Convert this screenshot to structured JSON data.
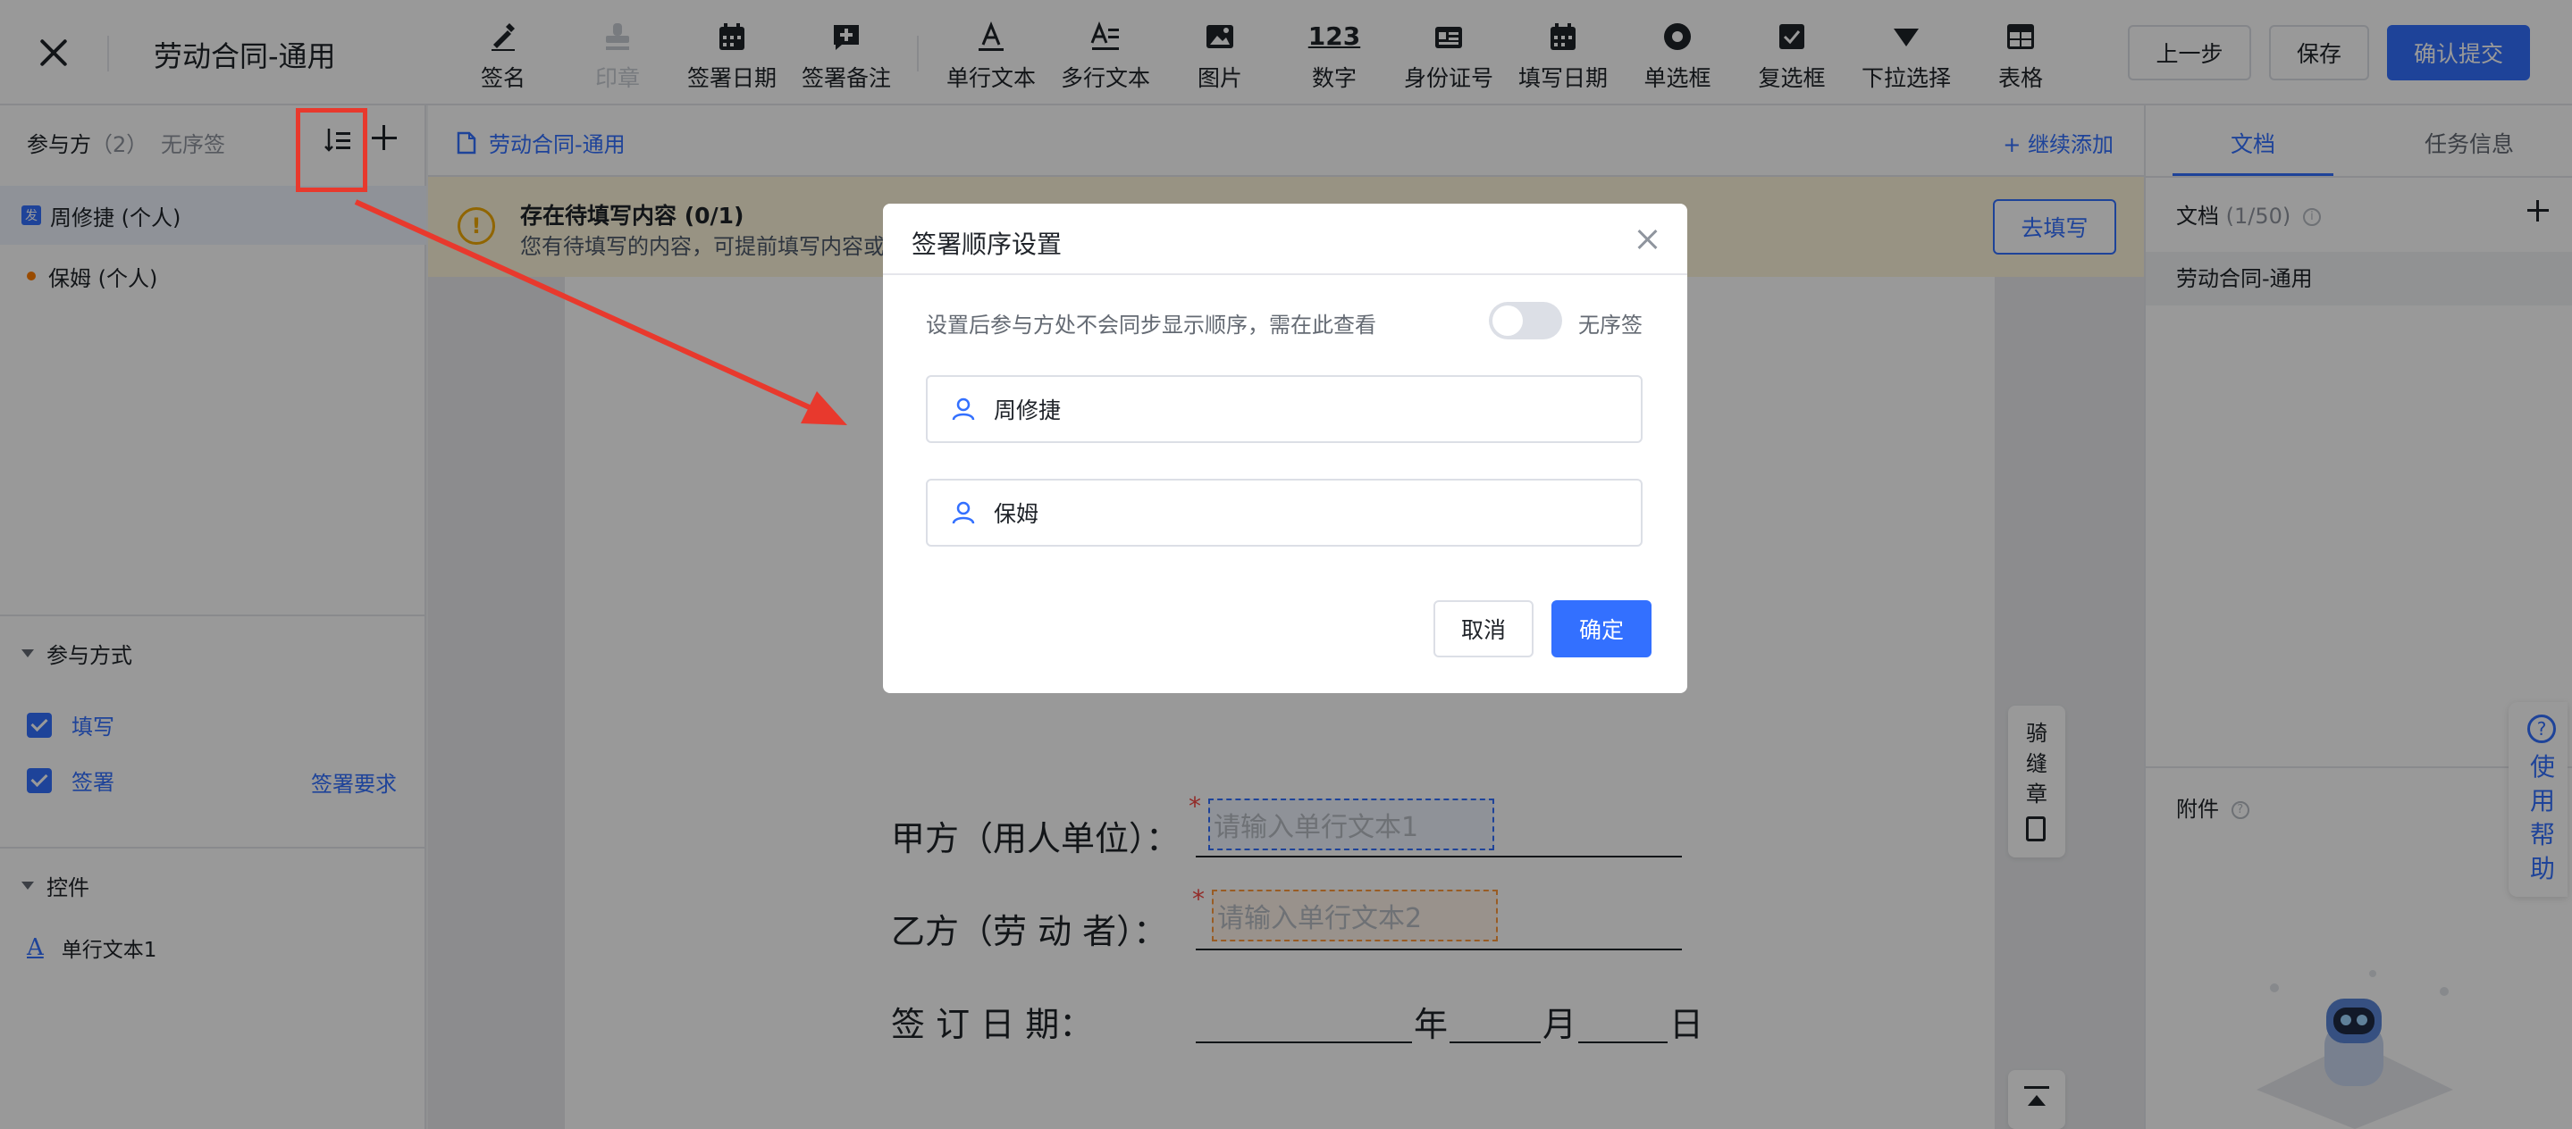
{
  "topbar": {
    "title": "劳动合同-通用",
    "tools": [
      {
        "label": "签名",
        "icon": "signature-icon"
      },
      {
        "label": "印章",
        "icon": "stamp-icon",
        "disabled": true
      },
      {
        "label": "签署日期",
        "icon": "calendar-icon"
      },
      {
        "label": "签署备注",
        "icon": "note-plus-icon"
      },
      {
        "label": "单行文本",
        "icon": "text-icon"
      },
      {
        "label": "多行文本",
        "icon": "multiline-text-icon"
      },
      {
        "label": "图片",
        "icon": "image-icon"
      },
      {
        "label": "数字",
        "icon": "number-icon"
      },
      {
        "label": "身份证号",
        "icon": "id-card-icon"
      },
      {
        "label": "填写日期",
        "icon": "calendar-icon"
      },
      {
        "label": "单选框",
        "icon": "radio-icon"
      },
      {
        "label": "复选框",
        "icon": "checkbox-icon"
      },
      {
        "label": "下拉选择",
        "icon": "dropdown-icon"
      },
      {
        "label": "表格",
        "icon": "table-icon"
      }
    ],
    "number_glyph": "123",
    "prev_label": "上一步",
    "save_label": "保存",
    "submit_label": "确认提交"
  },
  "left": {
    "parties_label": "参与方",
    "parties_count": "（2）",
    "unordered_label": "无序签",
    "parties": [
      {
        "badge": "发",
        "name": "周修捷 (个人)"
      },
      {
        "name": "保姆 (个人)"
      }
    ],
    "mode_title": "参与方式",
    "mode_fill": "填写",
    "mode_sign": "签署",
    "sign_requirements": "签署要求",
    "controls_title": "控件",
    "control_item": "单行文本1",
    "control_icon_glyph": "A"
  },
  "center": {
    "doc_name": "劳动合同-通用",
    "continue_add": "+ 继续添加",
    "banner_title": "存在待填写内容 (0/1)",
    "banner_desc": "您有待填写的内容，可提前填写内容或",
    "banner_button": "去填写",
    "party_a_label": "甲方（用人单位）：",
    "party_b_label": "乙方（劳  动  者）：",
    "date_label": "签    订    日    期：",
    "field1_placeholder": "请输入单行文本1",
    "field2_placeholder": "请输入单行文本2",
    "year": "年",
    "month": "月",
    "day": "日",
    "side_label": "骑缝章",
    "required_mark": "*"
  },
  "right": {
    "tab_doc": "文档",
    "tab_task": "任务信息",
    "doc_label": "文档",
    "doc_count": "(1/50)",
    "file_name": "劳动合同-通用",
    "attach_label": "附件",
    "help_label": "使用帮助",
    "info_glyph": "i",
    "help_glyph": "?"
  },
  "modal": {
    "title": "签署顺序设置",
    "desc": "设置后参与方处不会同步显示顺序，需在此查看",
    "toggle_label": "无序签",
    "toggle_on": false,
    "signers": [
      "周修捷",
      "保姆"
    ],
    "cancel": "取消",
    "confirm": "确定"
  },
  "colors": {
    "primary": "#3370ff",
    "annotation_red": "#e8392d",
    "warning_bg": "#fef6db",
    "warning_icon": "#f0a800"
  }
}
